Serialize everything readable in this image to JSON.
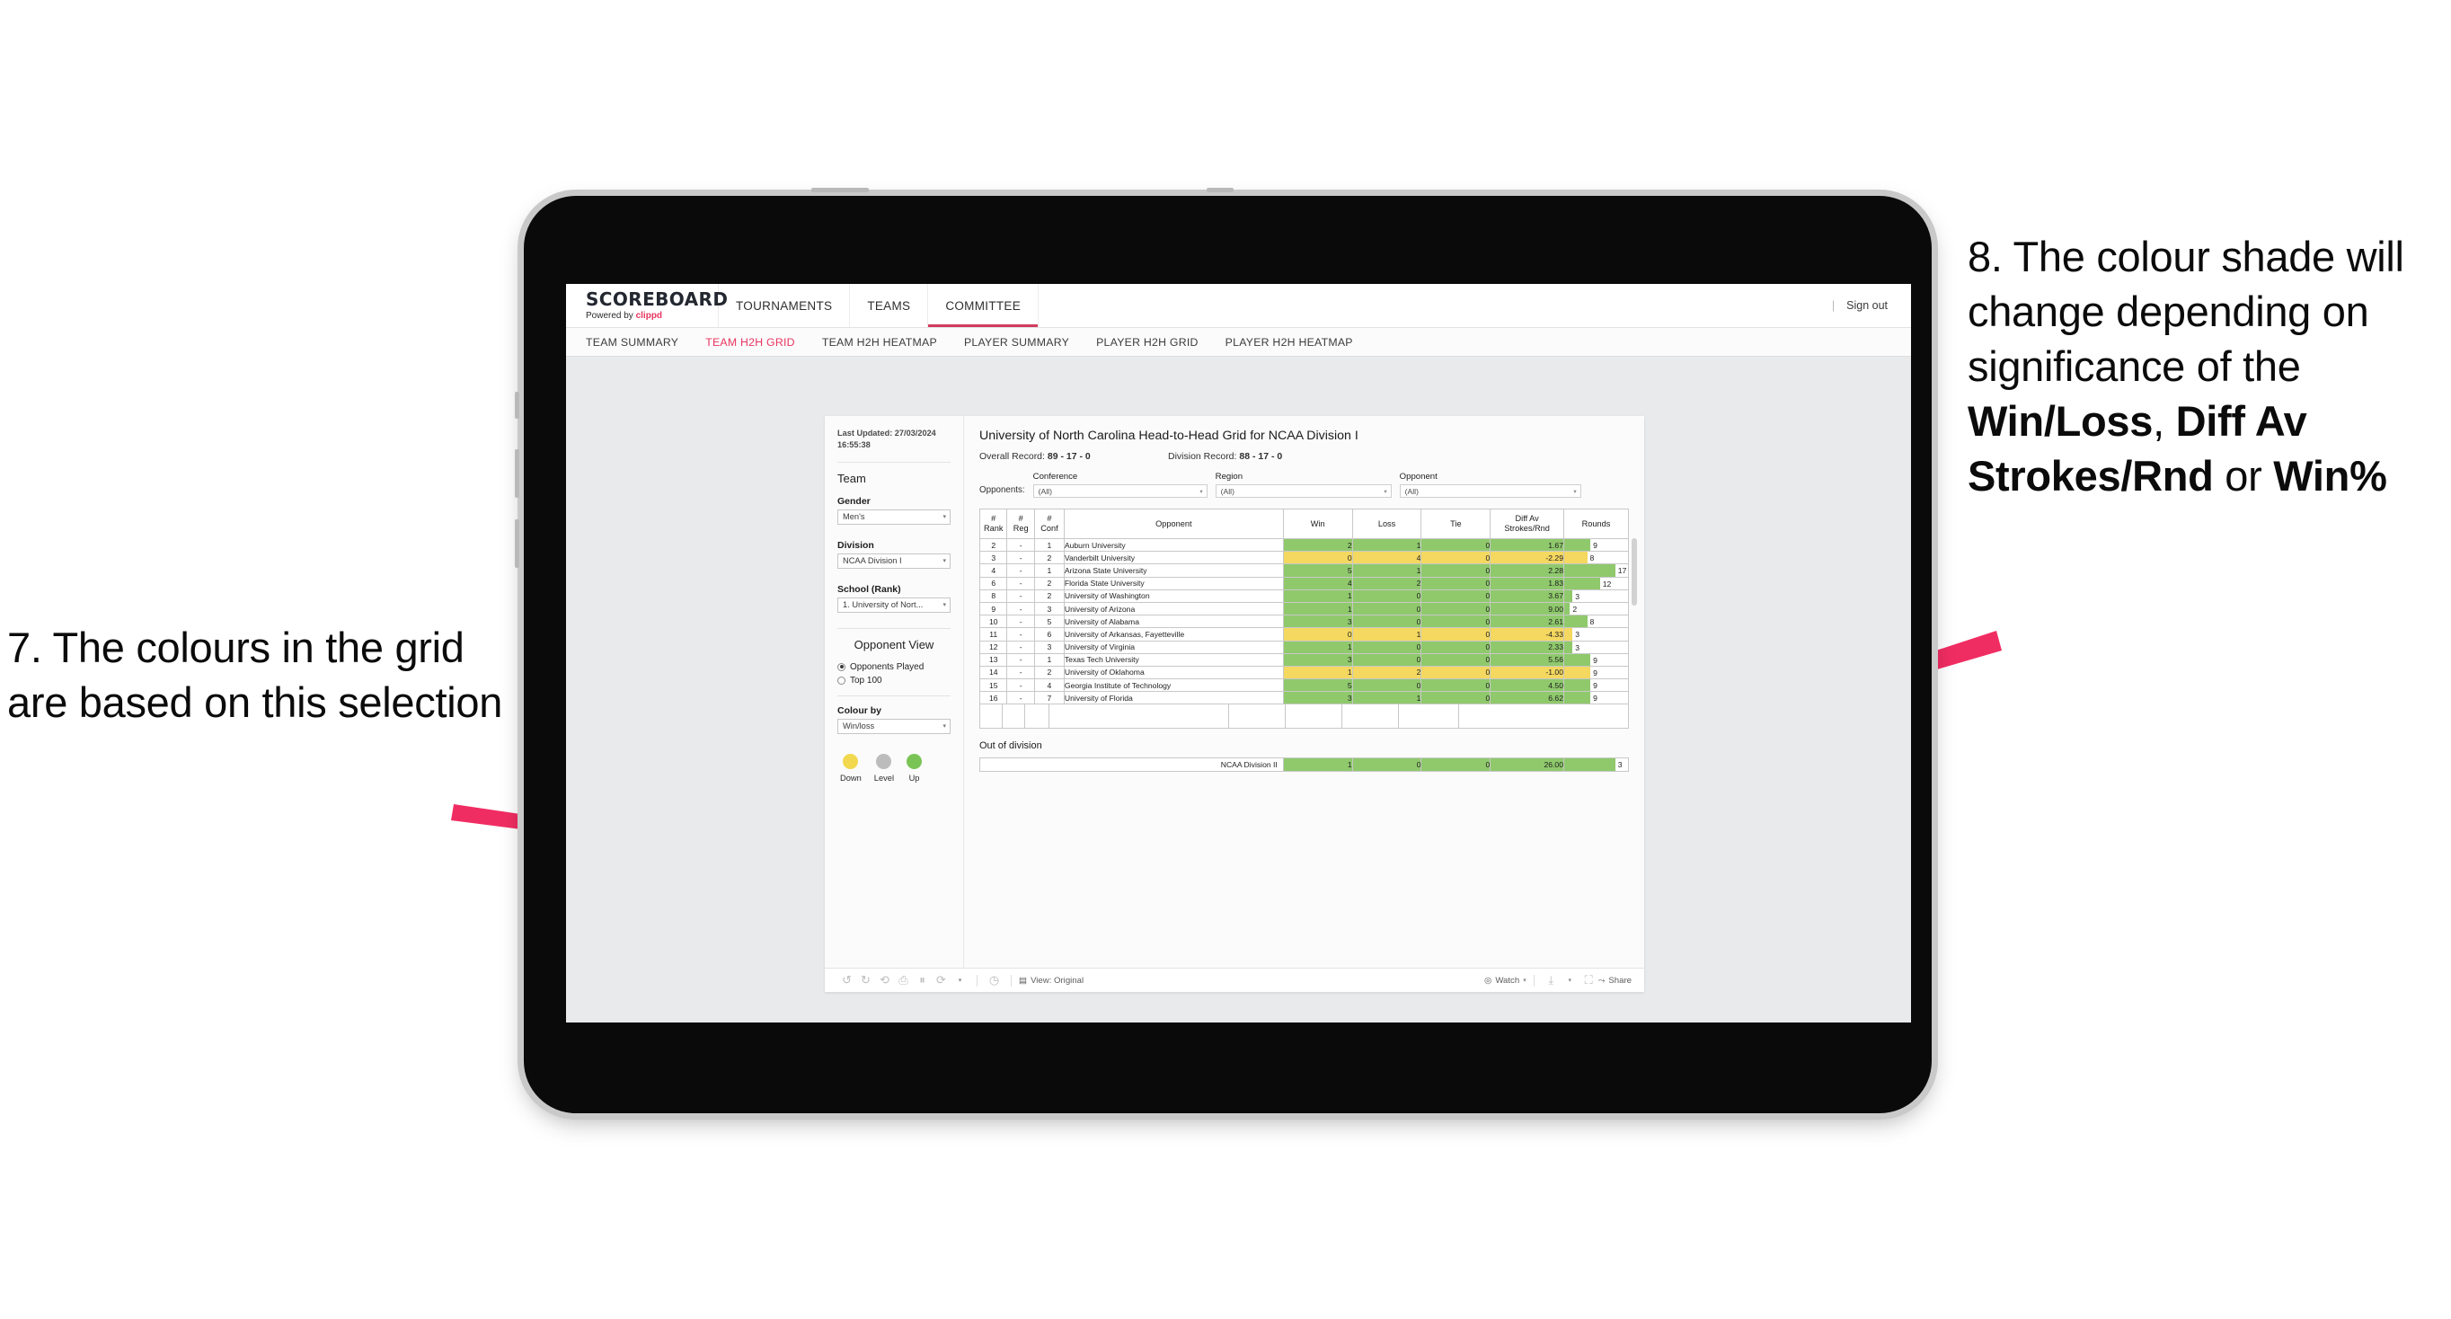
{
  "annotations": {
    "left": "7. The colours in the grid are based on this selection",
    "right_parts": [
      {
        "text": "8. The colour shade will change depending on significance of the ",
        "bold": false
      },
      {
        "text": "Win/Loss",
        "bold": true
      },
      {
        "text": ", ",
        "bold": false
      },
      {
        "text": "Diff Av Strokes/Rnd",
        "bold": true
      },
      {
        "text": " or ",
        "bold": false
      },
      {
        "text": "Win%",
        "bold": true
      }
    ],
    "arrow_color": "#F02D62"
  },
  "app": {
    "brand": {
      "title": "SCOREBOARD",
      "powered_prefix": "Powered by",
      "powered_name": "clippd"
    },
    "top_nav": [
      {
        "label": "TOURNAMENTS",
        "active": false
      },
      {
        "label": "TEAMS",
        "active": false
      },
      {
        "label": "COMMITTEE",
        "active": true
      }
    ],
    "sign_out": "Sign out",
    "sub_nav": [
      {
        "label": "TEAM SUMMARY",
        "active": false
      },
      {
        "label": "TEAM H2H GRID",
        "active": true
      },
      {
        "label": "TEAM H2H HEATMAP",
        "active": false
      },
      {
        "label": "PLAYER SUMMARY",
        "active": false
      },
      {
        "label": "PLAYER H2H GRID",
        "active": false
      },
      {
        "label": "PLAYER H2H HEATMAP",
        "active": false
      }
    ]
  },
  "filters": {
    "last_updated": "Last Updated: 27/03/2024 16:55:38",
    "team_heading": "Team",
    "gender": {
      "label": "Gender",
      "value": "Men's"
    },
    "division": {
      "label": "Division",
      "value": "NCAA Division I"
    },
    "school": {
      "label": "School (Rank)",
      "value": "1. University of Nort..."
    },
    "opponent_view": {
      "heading": "Opponent View",
      "options": [
        {
          "label": "Opponents Played",
          "selected": true
        },
        {
          "label": "Top 100",
          "selected": false
        }
      ]
    },
    "colour_by": {
      "label": "Colour by",
      "value": "Win/loss"
    },
    "legend": [
      {
        "label": "Down",
        "color": "#F2D84F"
      },
      {
        "label": "Level",
        "color": "#BCBCBC"
      },
      {
        "label": "Up",
        "color": "#7AC456"
      }
    ]
  },
  "content": {
    "title": "University of North Carolina Head-to-Head Grid for NCAA Division I",
    "overall_record_label": "Overall Record:",
    "overall_record_value": "89 - 17 - 0",
    "division_record_label": "Division Record:",
    "division_record_value": "88 - 17 - 0",
    "opponents_label": "Opponents:",
    "opponent_filters": [
      {
        "title": "Conference",
        "value": "(All)"
      },
      {
        "title": "Region",
        "value": "(All)"
      },
      {
        "title": "Opponent",
        "value": "(All)"
      }
    ],
    "columns": [
      "# Rank",
      "# Reg",
      "# Conf",
      "Opponent",
      "Win",
      "Loss",
      "Tie",
      "Diff Av Strokes/Rnd",
      "Rounds"
    ],
    "column_lines": [
      [
        "#",
        "Rank"
      ],
      [
        "#",
        "Reg"
      ],
      [
        "#",
        "Conf"
      ],
      [
        "Opponent",
        ""
      ],
      [
        "Win",
        ""
      ],
      [
        "Loss",
        ""
      ],
      [
        "Tie",
        ""
      ],
      [
        "Diff Av",
        "Strokes/Rnd"
      ],
      [
        "Rounds",
        ""
      ]
    ],
    "out_of_division_title": "Out of division"
  },
  "chart_data": {
    "type": "table",
    "title": "University of North Carolina Head-to-Head Grid for NCAA Division I",
    "colour_by": "Win/loss",
    "colour_scale": {
      "up": "#8FC96C",
      "down": "#F4D860",
      "level": "#BCBCBC"
    },
    "columns": [
      "# Rank",
      "# Reg",
      "# Conf",
      "Opponent",
      "Win",
      "Loss",
      "Tie",
      "Diff Av Strokes/Rnd",
      "Rounds"
    ],
    "rows": [
      {
        "rank": "2",
        "reg": "-",
        "conf": "1",
        "opponent": "Auburn University",
        "win": "2",
        "loss": "1",
        "tie": "0",
        "diff": "1.67",
        "rounds": "9",
        "tone": "g",
        "bar_pct": 41
      },
      {
        "rank": "3",
        "reg": "-",
        "conf": "2",
        "opponent": "Vanderbilt University",
        "win": "0",
        "loss": "4",
        "tie": "0",
        "diff": "-2.29",
        "rounds": "8",
        "tone": "y",
        "bar_pct": 36
      },
      {
        "rank": "4",
        "reg": "-",
        "conf": "1",
        "opponent": "Arizona State University",
        "win": "5",
        "loss": "1",
        "tie": "0",
        "diff": "2.28",
        "rounds": "17",
        "tone": "g",
        "bar_pct": 80
      },
      {
        "rank": "6",
        "reg": "-",
        "conf": "2",
        "opponent": "Florida State University",
        "win": "4",
        "loss": "2",
        "tie": "0",
        "diff": "1.83",
        "rounds": "12",
        "tone": "g",
        "bar_pct": 56
      },
      {
        "rank": "8",
        "reg": "-",
        "conf": "2",
        "opponent": "University of Washington",
        "win": "1",
        "loss": "0",
        "tie": "0",
        "diff": "3.67",
        "rounds": "3",
        "tone": "g",
        "bar_pct": 13
      },
      {
        "rank": "9",
        "reg": "-",
        "conf": "3",
        "opponent": "University of Arizona",
        "win": "1",
        "loss": "0",
        "tie": "0",
        "diff": "9.00",
        "rounds": "2",
        "tone": "g",
        "bar_pct": 9
      },
      {
        "rank": "10",
        "reg": "-",
        "conf": "5",
        "opponent": "University of Alabama",
        "win": "3",
        "loss": "0",
        "tie": "0",
        "diff": "2.61",
        "rounds": "8",
        "tone": "g",
        "bar_pct": 36
      },
      {
        "rank": "11",
        "reg": "-",
        "conf": "6",
        "opponent": "University of Arkansas, Fayetteville",
        "win": "0",
        "loss": "1",
        "tie": "0",
        "diff": "-4.33",
        "rounds": "3",
        "tone": "y",
        "bar_pct": 13
      },
      {
        "rank": "12",
        "reg": "-",
        "conf": "3",
        "opponent": "University of Virginia",
        "win": "1",
        "loss": "0",
        "tie": "0",
        "diff": "2.33",
        "rounds": "3",
        "tone": "g",
        "bar_pct": 13
      },
      {
        "rank": "13",
        "reg": "-",
        "conf": "1",
        "opponent": "Texas Tech University",
        "win": "3",
        "loss": "0",
        "tie": "0",
        "diff": "5.56",
        "rounds": "9",
        "tone": "g",
        "bar_pct": 41
      },
      {
        "rank": "14",
        "reg": "-",
        "conf": "2",
        "opponent": "University of Oklahoma",
        "win": "1",
        "loss": "2",
        "tie": "0",
        "diff": "-1.00",
        "rounds": "9",
        "tone": "y",
        "bar_pct": 41
      },
      {
        "rank": "15",
        "reg": "-",
        "conf": "4",
        "opponent": "Georgia Institute of Technology",
        "win": "5",
        "loss": "0",
        "tie": "0",
        "diff": "4.50",
        "rounds": "9",
        "tone": "g",
        "bar_pct": 41
      },
      {
        "rank": "16",
        "reg": "-",
        "conf": "7",
        "opponent": "University of Florida",
        "win": "3",
        "loss": "1",
        "tie": "0",
        "diff": "6.62",
        "rounds": "9",
        "tone": "g",
        "bar_pct": 41
      }
    ],
    "out_of_division": [
      {
        "label": "NCAA Division II",
        "win": "1",
        "loss": "0",
        "tie": "0",
        "diff": "26.00",
        "rounds": "3",
        "tone": "g",
        "bar_pct": 80
      }
    ]
  },
  "toolbar": {
    "view_label": "View: Original",
    "watch_label": "Watch",
    "share_label": "Share"
  }
}
